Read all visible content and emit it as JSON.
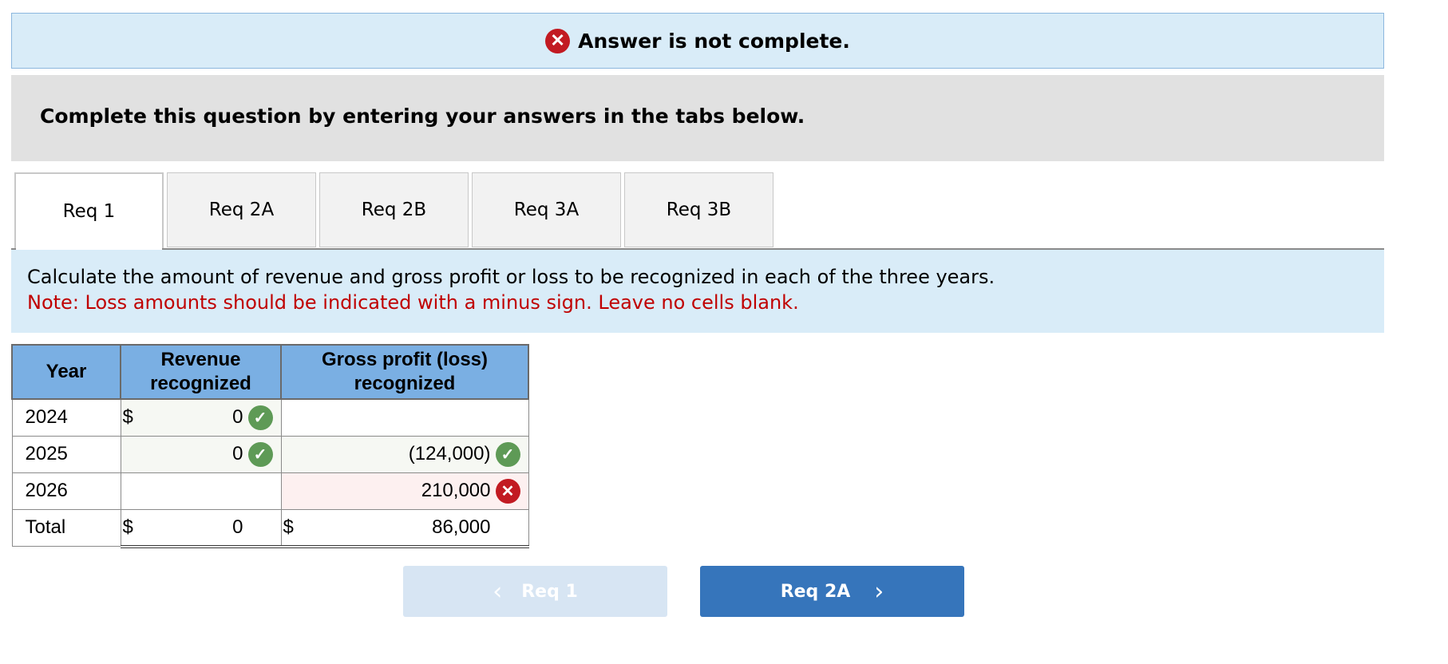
{
  "banner": {
    "icon": "error-x-icon",
    "text": "Answer is not complete."
  },
  "instructions": "Complete this question by entering your answers in the tabs below.",
  "tabs": [
    {
      "label": "Req 1",
      "active": true
    },
    {
      "label": "Req 2A",
      "active": false
    },
    {
      "label": "Req 2B",
      "active": false
    },
    {
      "label": "Req 3A",
      "active": false
    },
    {
      "label": "Req 3B",
      "active": false
    }
  ],
  "prompt": {
    "main": "Calculate the amount of revenue and gross profit or loss to be recognized in each of the three years.",
    "note": "Note: Loss amounts should be indicated with a minus sign. Leave no cells blank."
  },
  "table": {
    "headers": {
      "year": "Year",
      "revenue": "Revenue recognized",
      "gross_profit": "Gross profit (loss) recognized"
    },
    "currency": "$",
    "rows": [
      {
        "year": "2024",
        "revenue": "0",
        "revenue_status": "correct",
        "gross_profit": "",
        "gp_status": ""
      },
      {
        "year": "2025",
        "revenue": "0",
        "revenue_status": "correct",
        "gross_profit": "(124,000)",
        "gp_status": "correct"
      },
      {
        "year": "2026",
        "revenue": "",
        "revenue_status": "",
        "gross_profit": "210,000",
        "gp_status": "incorrect"
      }
    ],
    "total": {
      "label": "Total",
      "revenue": "0",
      "gross_profit": "86,000"
    }
  },
  "nav": {
    "prev_label": "Req 1",
    "next_label": "Req 2A"
  },
  "colors": {
    "header_bg": "#7aafe3",
    "correct": "#5e9a56",
    "incorrect": "#c21a22",
    "next_button": "#3675bb"
  }
}
